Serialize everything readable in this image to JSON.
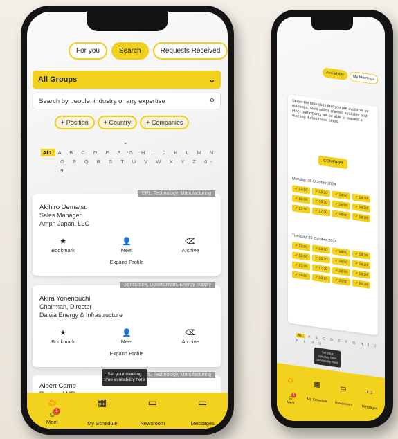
{
  "tabs": [
    {
      "label": "For you",
      "active": false
    },
    {
      "label": "Search",
      "active": true
    },
    {
      "label": "Requests Received",
      "active": false
    }
  ],
  "groups_select": {
    "value": "All Groups"
  },
  "search": {
    "placeholder": "Search by people, industry or any expertise"
  },
  "filters": [
    "+ Position",
    "+ Country",
    "+ Companies"
  ],
  "alphabet": {
    "all": "ALL",
    "row1": "A B C D E F G H I J K L M N",
    "row2": "O P Q R S T U V W X Y Z 0-9"
  },
  "people": [
    {
      "tag": "EPL, Technology, Manufacturing",
      "name": "Akihiro Uematsu",
      "title": "Sales Manager",
      "company": "Amph Japan, LLC",
      "bookmark": "Bookmark",
      "meet": "Meet",
      "archive": "Archive",
      "expand": "Expand Profile"
    },
    {
      "tag": "Agriculture, Downstream, Energy Supply",
      "name": "Akira Yonenouchi",
      "title": "Chairman, Director",
      "company": "Daiwa Energy & Infrastructure",
      "bookmark": "Bookmark",
      "meet": "Meet",
      "archive": "Archive",
      "expand": "Expand Profile"
    },
    {
      "tag": "EPL, Technology, Manufacturing",
      "name": "Albert Camp",
      "title": "Regional MD",
      "company": "",
      "bookmark": "",
      "meet": "",
      "archive": "",
      "expand": ""
    }
  ],
  "tooltip": {
    "text": "Set your meeting time availability here"
  },
  "bottom_nav": [
    {
      "label": "Meet",
      "icon": "handshake-icon",
      "badge": "1"
    },
    {
      "label": "My Schedule",
      "icon": "calendar-icon"
    },
    {
      "label": "Newsroom",
      "icon": "chat-icon"
    },
    {
      "label": "Messages",
      "icon": "message-icon"
    }
  ],
  "right_phone": {
    "tabs": [
      {
        "label": "Availability",
        "active": true
      },
      {
        "label": "My Meetings",
        "active": false
      }
    ],
    "intro": "Select the time slots that you are available for meetings. Slots will be marked available and other participants will be able to request a meeting during those times.",
    "confirm_label": "CONFIRM",
    "days": [
      {
        "label": "Monday, 28 October 2024",
        "slots": [
          "13:00",
          "13:30",
          "14:00",
          "14:30",
          "15:00",
          "15:30",
          "16:00",
          "16:30",
          "17:00",
          "17:30",
          "18:00",
          "18:30"
        ]
      },
      {
        "label": "Tuesday, 29 October 2024",
        "slots": [
          "13:00",
          "13:30",
          "14:00",
          "14:30",
          "15:00",
          "15:30",
          "16:00",
          "16:30",
          "17:00",
          "17:30",
          "18:00",
          "18:30",
          "19:00",
          "19:30",
          "20:00",
          "20:30"
        ]
      }
    ],
    "alphabet": "A B C D E F G H I J K L M N",
    "tooltip": "Set your meeting time availability here",
    "nav": [
      "Meet",
      "My Schedule",
      "Newsroom",
      "Messages"
    ]
  },
  "colors": {
    "accent": "#f3d21e",
    "badge": "#e23d2e",
    "frame": "#141414"
  }
}
